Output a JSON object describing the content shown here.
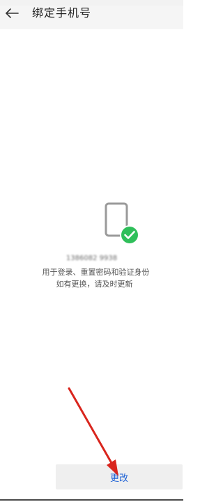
{
  "header": {
    "back_icon": "arrow-left-icon",
    "title": "绑定手机号"
  },
  "phone_section": {
    "icon": "phone-check-icon",
    "check_color": "#2fbf5a",
    "phone_number": "1386082 9938",
    "description_line1": "用于登录、重置密码和验证身份",
    "description_line2": "如有更换，请及时更新"
  },
  "actions": {
    "change_label": "更改",
    "label_color": "#1f63d6"
  },
  "annotation": {
    "arrow_color": "#d9251d"
  }
}
